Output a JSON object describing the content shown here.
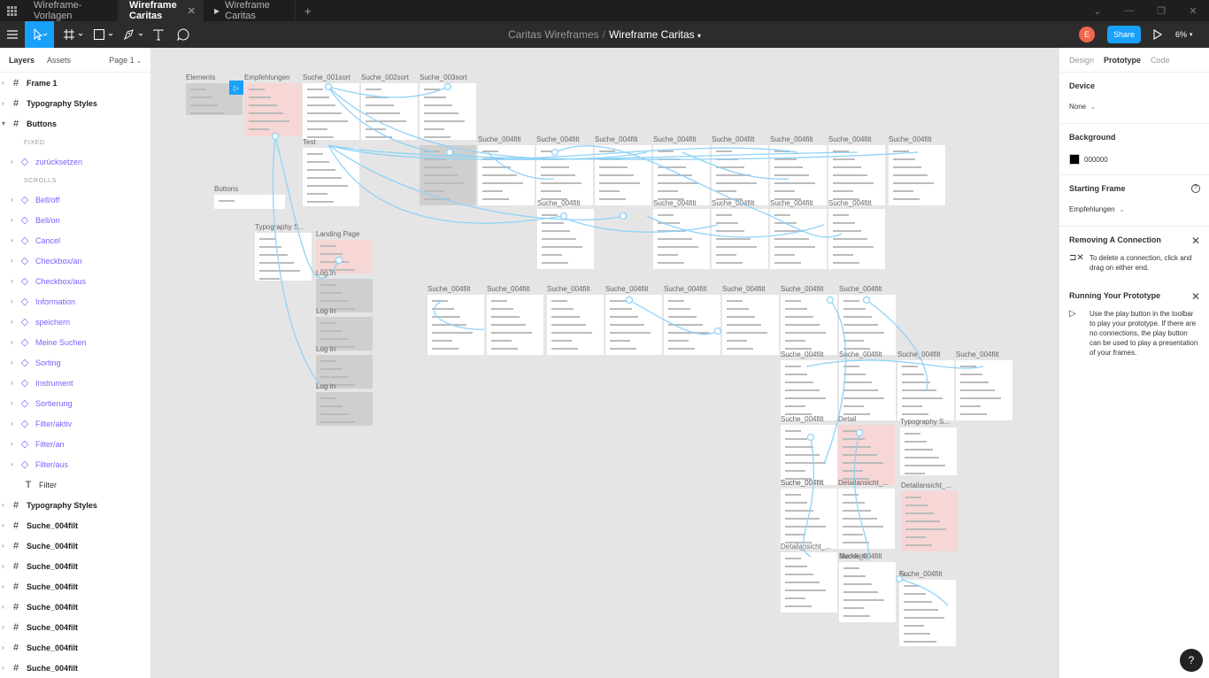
{
  "tabs": [
    {
      "label": "Wireframe-Vorlagen",
      "active": false
    },
    {
      "label": "Wireframe Caritas",
      "active": true
    },
    {
      "label": "Wireframe Caritas",
      "active": false,
      "prototype": true
    }
  ],
  "document": {
    "project": "Caritas Wireframes",
    "separator": "/",
    "file": "Wireframe Caritas"
  },
  "toolbar": {
    "avatar_initial": "E",
    "share_label": "Share",
    "zoom": "6%"
  },
  "left_panel": {
    "tab_layers": "Layers",
    "tab_assets": "Assets",
    "page": "Page 1",
    "layers": [
      {
        "kind": "frame",
        "name": "Frame 1"
      },
      {
        "kind": "frame",
        "name": "Typography Styles"
      },
      {
        "kind": "frame-open",
        "name": "Buttons"
      },
      {
        "kind": "section",
        "name": "FIXED"
      },
      {
        "kind": "comp",
        "name": "zurücksetzen"
      },
      {
        "kind": "section",
        "name": "SCROLLS"
      },
      {
        "kind": "comp",
        "name": "Bell/off"
      },
      {
        "kind": "comp",
        "name": "Bell/on"
      },
      {
        "kind": "comp",
        "name": "Cancel"
      },
      {
        "kind": "comp",
        "name": "Checkbox/an"
      },
      {
        "kind": "comp",
        "name": "Checkbox/aus"
      },
      {
        "kind": "comp",
        "name": "Information"
      },
      {
        "kind": "comp",
        "name": "speichern"
      },
      {
        "kind": "comp",
        "name": "Meine Suchen"
      },
      {
        "kind": "comp",
        "name": "Sorting"
      },
      {
        "kind": "comp",
        "name": "Instrument"
      },
      {
        "kind": "comp",
        "name": "Sortierung"
      },
      {
        "kind": "comp",
        "name": "Filter/aktiv"
      },
      {
        "kind": "comp",
        "name": "Filter/an"
      },
      {
        "kind": "comp",
        "name": "Filter/aus"
      },
      {
        "kind": "text",
        "name": "Filter"
      },
      {
        "kind": "frame",
        "name": "Typography Styles"
      },
      {
        "kind": "frame",
        "name": "Suche_004filt"
      },
      {
        "kind": "frame",
        "name": "Suche_004filt"
      },
      {
        "kind": "frame",
        "name": "Suche_004filt"
      },
      {
        "kind": "frame",
        "name": "Suche_004filt"
      },
      {
        "kind": "frame",
        "name": "Suche_004filt"
      },
      {
        "kind": "frame",
        "name": "Suche_004filt"
      },
      {
        "kind": "frame",
        "name": "Suche_004filt"
      },
      {
        "kind": "frame",
        "name": "Suche_004filt"
      },
      {
        "kind": "frame",
        "name": "Suche_004filt"
      }
    ]
  },
  "right_panel": {
    "tabs": {
      "design": "Design",
      "prototype": "Prototype",
      "code": "Code"
    },
    "device": {
      "heading": "Device",
      "value": "None"
    },
    "background": {
      "heading": "Background",
      "value": "000000"
    },
    "starting_frame": {
      "heading": "Starting Frame",
      "value": "Empfehlungen"
    },
    "removing": {
      "heading": "Removing A Connection",
      "text": "To delete a connection, click and drag on either end."
    },
    "running": {
      "heading": "Running Your Prototype",
      "text": "Use the play button in the toolbar to play your prototype. If there are no connections, the play button can be used to play a presentation of your frames."
    }
  },
  "canvas": {
    "frames": [
      {
        "label": "Elements",
        "style": "gray"
      },
      {
        "label": "Empfehlungen",
        "style": "pink"
      },
      {
        "label": "Suche_001sort",
        "style": "white"
      },
      {
        "label": "Suche_002sort",
        "style": "white"
      },
      {
        "label": "Suche_003sort",
        "style": "white"
      },
      {
        "label": "Test",
        "style": "white"
      },
      {
        "label": "Buttons",
        "style": "white"
      },
      {
        "label": "Typography S...",
        "style": "white"
      },
      {
        "label": "Landing Page",
        "style": "pink"
      },
      {
        "label": "Log In",
        "style": "gray"
      },
      {
        "label": "Log In",
        "style": "gray"
      },
      {
        "label": "Log In",
        "style": "gray"
      },
      {
        "label": "Log In",
        "style": "gray"
      },
      {
        "label": "",
        "style": "gray"
      },
      {
        "label": "Suche_004filt",
        "style": "white"
      },
      {
        "label": "Suche_004filt",
        "style": "white"
      },
      {
        "label": "Suche_004filt",
        "style": "white"
      },
      {
        "label": "Suche_004filt",
        "style": "white"
      },
      {
        "label": "Suche_004filt",
        "style": "white"
      },
      {
        "label": "Suche_004filt",
        "style": "white"
      },
      {
        "label": "Suche_004filt",
        "style": "white"
      },
      {
        "label": "Suche_004filt",
        "style": "white"
      },
      {
        "label": "Suche_004filt",
        "style": "white"
      },
      {
        "label": "Suche_004filt",
        "style": "white"
      },
      {
        "label": "Suche_004filt",
        "style": "white"
      },
      {
        "label": "Suche_004filt",
        "style": "white"
      },
      {
        "label": "Suche_004filt",
        "style": "white"
      },
      {
        "label": "Suche_004filt",
        "style": "white"
      },
      {
        "label": "Suche_004filt",
        "style": "white"
      },
      {
        "label": "Suche_004filt",
        "style": "white"
      },
      {
        "label": "Suche_004filt",
        "style": "white"
      },
      {
        "label": "Suche_004filt",
        "style": "white"
      },
      {
        "label": "Suche_004filt",
        "style": "white"
      },
      {
        "label": "Suche_004filt",
        "style": "white"
      },
      {
        "label": "Suche_004filt",
        "style": "white"
      },
      {
        "label": "Suche_004filt",
        "style": "white"
      },
      {
        "label": "Suche_004filt",
        "style": "white"
      },
      {
        "label": "Suche_004filt",
        "style": "white"
      },
      {
        "label": "Suche_004filt",
        "style": "white"
      },
      {
        "label": "Suche_004filt",
        "style": "white"
      },
      {
        "label": "Suche_004filt",
        "style": "white"
      },
      {
        "label": "Suche_004filt",
        "style": "white"
      },
      {
        "label": "Suche_004filt",
        "style": "white"
      },
      {
        "label": "Suche_004filt",
        "style": "white"
      },
      {
        "label": "Detail",
        "style": "pink"
      },
      {
        "label": "Typography S...",
        "style": "white"
      },
      {
        "label": "Suche_004filt",
        "style": "white"
      },
      {
        "label": "Detailansicht_...",
        "style": "white"
      },
      {
        "label": "Detailansicht_...",
        "style": "pink"
      },
      {
        "label": "Detailansicht_...",
        "style": "white"
      },
      {
        "label": "Merkliste",
        "style": "white"
      },
      {
        "label": "Fr...",
        "style": "white"
      }
    ]
  },
  "help_label": "?"
}
